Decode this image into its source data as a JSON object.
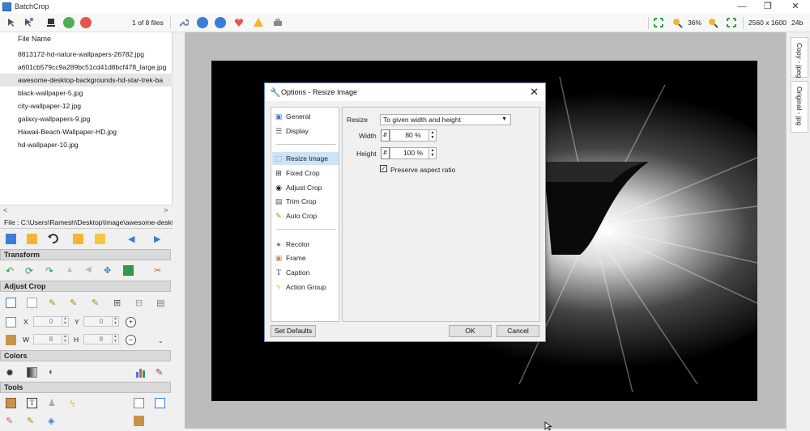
{
  "app": {
    "title": "BatchCrop"
  },
  "window_controls": {
    "minimize": "—",
    "restore": "❐",
    "close": "✕"
  },
  "toolbar": {
    "file_count": "1 of 8 files",
    "zoom": "36%",
    "dimensions": "2560 x 1600",
    "bit_depth": "24b"
  },
  "file_list": {
    "header": "File Name",
    "items": [
      "8813172-hd-nature-wallpapers-26782.jpg",
      "a601cb579cc9a289bc51cd41d8bcf478_large.jpg",
      "awesome-desktop-backgrounds-hd-star-trek-ba",
      "black-wallpaper-5.jpg",
      "city-wallpaper-12.jpg",
      "galaxy-wallpapers-9.jpg",
      "Hawaii-Beach-Wallpaper-HD.jpg",
      "hd-wallpaper-10.jpg"
    ],
    "selected_index": 2
  },
  "file_path": "File : C:\\Users\\Ramesh\\Desktop\\Image\\awesome-desktop",
  "sections": {
    "transform": "Transform",
    "adjust_crop": "Adjust Crop",
    "colors": "Colors",
    "tools": "Tools"
  },
  "adjust_crop_fields": {
    "x_label": "X",
    "x_value": "0",
    "y_label": "Y",
    "y_value": "0",
    "w_label": "W",
    "w_value": "8",
    "h_label": "H",
    "h_value": "8"
  },
  "right_tabs": {
    "copy": "Copy - jpeg",
    "original": "Original - jpg"
  },
  "dialog": {
    "title": "Options - Resize Image",
    "nav": [
      "General",
      "Display",
      "Resize Image",
      "Fixed Crop",
      "Adjust Crop",
      "Trim Crop",
      "Auto Crop",
      "Recolor",
      "Frame",
      "Caption",
      "Action Group"
    ],
    "selected_nav": "Resize Image",
    "resize_label": "Resize",
    "resize_mode": "To given width and height",
    "width_label": "Width",
    "width_value": "80 %",
    "height_label": "Height",
    "height_value": "100 %",
    "preserve_label": "Preserve aspect ratio",
    "preserve_checked": true,
    "set_defaults": "Set Defaults",
    "ok": "OK",
    "cancel": "Cancel"
  },
  "colors": {
    "accent_blue": "#3b7dd8",
    "selection": "#cce4f7",
    "section_header": "#d9d9d9",
    "canvas_bg": "#bcbcbc"
  }
}
